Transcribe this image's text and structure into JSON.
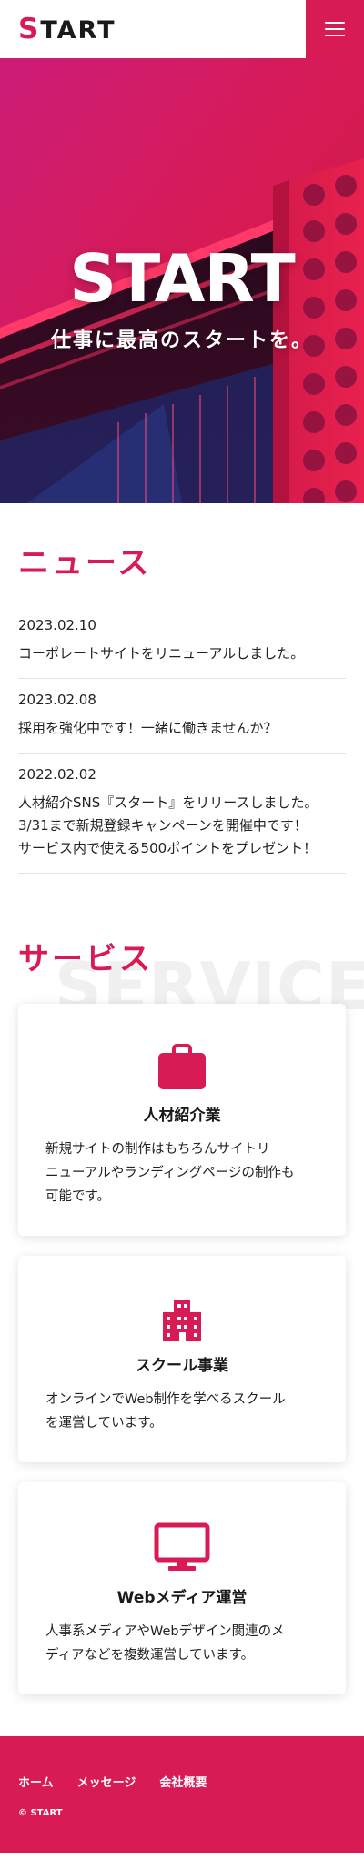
{
  "header": {
    "logo_initial": "S",
    "logo_rest": "TART",
    "menu_icon": "hamburger-menu-icon"
  },
  "hero": {
    "title": "START",
    "subtitle": "仕事に最高のスタートを。"
  },
  "news": {
    "heading": "ニュース",
    "items": [
      {
        "date": "2023.02.10",
        "lines": [
          "コーポレートサイトをリニューアルしました。"
        ]
      },
      {
        "date": "2023.02.08",
        "lines": [
          "採用を強化中です！一緒に働きませんか？"
        ]
      },
      {
        "date": "2022.02.02",
        "lines": [
          "人材紹介SNS『スタート』をリリースしました。",
          "3/31まで新規登録キャンペーンを開催中です！",
          "サービス内で使える500ポイントをプレゼント！"
        ]
      }
    ]
  },
  "services": {
    "heading": "サービス",
    "bg_text": "SERVICE",
    "cards": [
      {
        "icon": "briefcase-icon",
        "title": "人材紹介業",
        "lines": [
          "新規サイトの制作はもちろんサイトリ",
          "ニューアルやランディングページの制作も",
          "可能です。"
        ]
      },
      {
        "icon": "building-icon",
        "title": "スクール事業",
        "lines": [
          "オンラインでWeb制作を学べるスクール",
          "を運営しています。"
        ]
      },
      {
        "icon": "monitor-icon",
        "title": "Webメディア運営",
        "lines": [
          "人事系メディアやWebデザイン関連のメ",
          "ディアなどを複数運営しています。"
        ]
      }
    ]
  },
  "footer": {
    "nav": [
      "ホーム",
      "メッセージ",
      "会社概要"
    ],
    "copyright": "© START"
  },
  "colors": {
    "accent": "#d81b55",
    "text": "#222222",
    "footer_bg": "#d81b55"
  }
}
